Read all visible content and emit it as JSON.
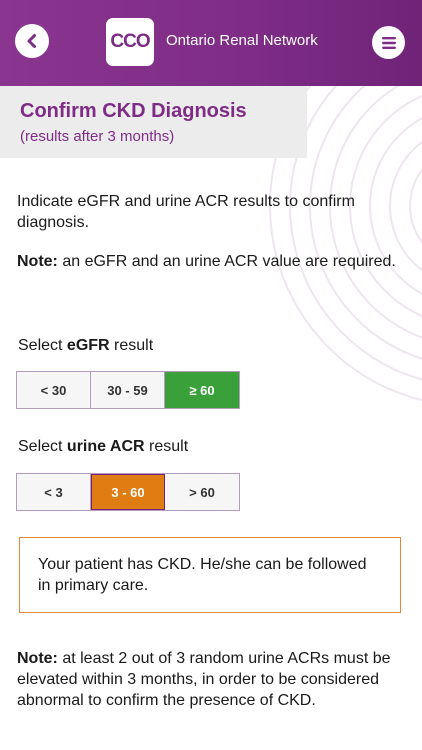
{
  "header": {
    "logo_text": "CCO",
    "org_name": "Ontario Renal Network",
    "icons": {
      "back": "chevron-left-icon",
      "menu": "hamburger-menu-icon"
    },
    "colors": {
      "brand": "#7e2c86"
    }
  },
  "page": {
    "title": "Confirm CKD Diagnosis",
    "subtitle": "(results after 3 months)"
  },
  "instructions": {
    "text": "Indicate eGFR and urine ACR results to confirm diagnosis.",
    "note_label": "Note:",
    "note_text": " an eGFR and an urine ACR value are required."
  },
  "egfr": {
    "label_prefix": "Select ",
    "label_bold": "eGFR",
    "label_suffix": " result",
    "options": [
      "< 30",
      "30 - 59",
      "≥ 60"
    ],
    "selected": "≥ 60",
    "selected_color": "#3aa03a"
  },
  "acr": {
    "label_prefix": "Select ",
    "label_bold": "urine ACR",
    "label_suffix": " result",
    "options": [
      "< 3",
      "3 - 60",
      "> 60"
    ],
    "selected": "3 - 60",
    "selected_color": "#e07d12"
  },
  "result": {
    "text": "Your patient has CKD. He/she can be followed in primary care."
  },
  "footer_note": {
    "label": "Note:",
    "text": " at least 2 out of 3 random urine ACRs must be elevated within 3 months, in order to be considered abnormal to confirm the presence of CKD."
  }
}
